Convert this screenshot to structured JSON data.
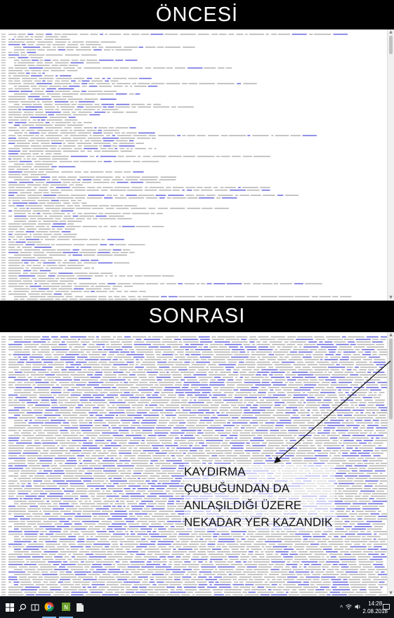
{
  "before": {
    "title": "ÖNCESİ"
  },
  "after": {
    "title": "SONRASI",
    "annotation": [
      "KAYDIRMA",
      "ÇUBUĞUNDAN DA",
      "ANLAŞILDIĞI ÜZERE",
      "NEKADAR YER KAZANDIK"
    ]
  },
  "scrollbar_before": {
    "thumb_fraction": 0.07
  },
  "scrollbar_after": {
    "thumb_fraction": 0.32
  },
  "taskbar": {
    "clock_time": "14:28",
    "clock_date": "2.08.2018",
    "icons": [
      "windows-icon",
      "search-icon",
      "task-view-icon",
      "chrome-icon",
      "notepad-plus-icon",
      "file-icon"
    ]
  },
  "colors": {
    "link": "#3b3bd6",
    "text": "#555555",
    "taskbar": "#101418"
  }
}
